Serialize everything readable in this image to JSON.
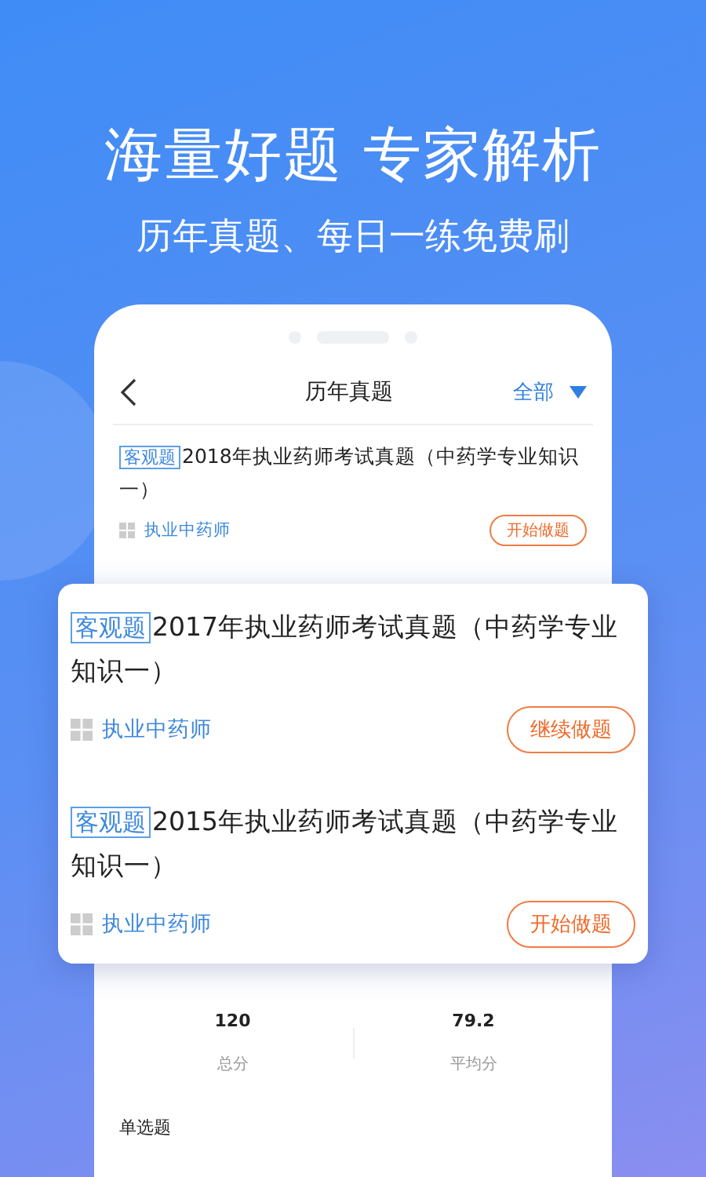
{
  "headline": "海量好题 专家解析",
  "subheadline": "历年真题、每日一练免费刷",
  "nav": {
    "title": "历年真题",
    "filter": "全部"
  },
  "items": [
    {
      "tag": "客观题",
      "title": "2018年执业药师考试真题（中药学专业知识一）",
      "category": "执业中药师",
      "action": "开始做题"
    }
  ],
  "featured_items": [
    {
      "tag": "客观题",
      "title": "2017年执业药师考试真题（中药学专业知识一）",
      "category": "执业中药师",
      "action": "继续做题"
    },
    {
      "tag": "客观题",
      "title": "2015年执业药师考试真题（中药学专业知识一）",
      "category": "执业中药师",
      "action": "开始做题"
    }
  ],
  "stats": [
    {
      "value": "120",
      "label": "总分"
    },
    {
      "value": "79.2",
      "label": "平均分"
    }
  ],
  "section_title": "单选题"
}
